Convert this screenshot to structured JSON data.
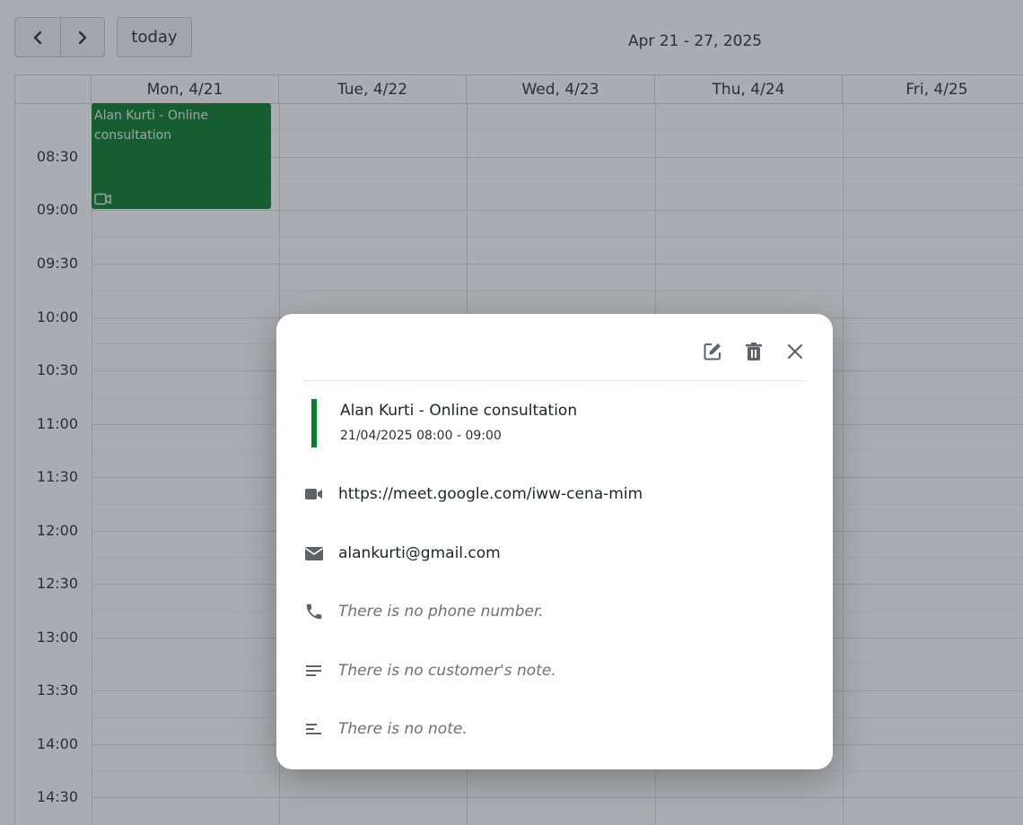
{
  "toolbar": {
    "prev_icon": "chevron-left-icon",
    "next_icon": "chevron-right-icon",
    "today_label": "today",
    "range_title": "Apr 21 - 27, 2025"
  },
  "calendar": {
    "days": [
      "Mon, 4/21",
      "Tue, 4/22",
      "Wed, 4/23",
      "Thu, 4/24",
      "Fri, 4/25"
    ],
    "time_labels": [
      "08:30",
      "09:00",
      "09:30",
      "10:00",
      "10:30",
      "11:00",
      "11:30",
      "12:00",
      "12:30",
      "13:00",
      "13:30",
      "14:00",
      "14:30"
    ],
    "event": {
      "title": "Alan Kurti - Online consultation",
      "icon": "video-icon",
      "color": "#0a7d2d"
    }
  },
  "modal": {
    "actions": [
      "edit-icon",
      "trash-icon",
      "close-icon"
    ],
    "title": "Alan Kurti - Online consultation",
    "datetime": "21/04/2025 08:00 - 09:00",
    "accent_color": "#0a7d2d",
    "meeting_link": "https://meet.google.com/iww-cena-mim",
    "email": "alankurti@gmail.com",
    "phone": "There is no phone number.",
    "customer_note": "There is no customer's note.",
    "note": "There is no note."
  }
}
